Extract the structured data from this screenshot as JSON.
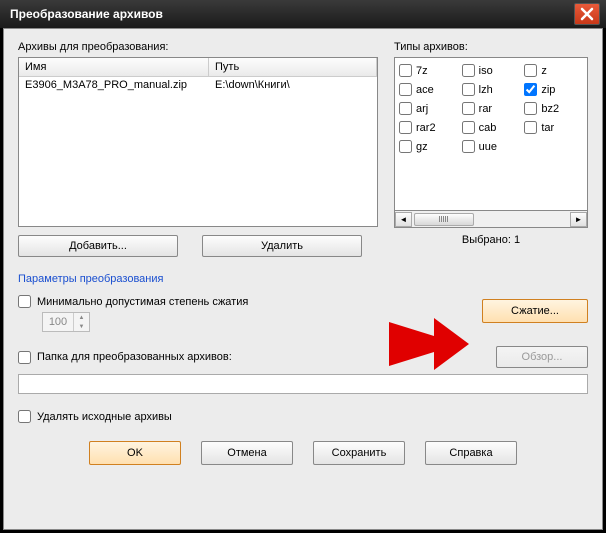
{
  "title": "Преобразование архивов",
  "archives": {
    "label": "Архивы для преобразования:",
    "col_name": "Имя",
    "col_path": "Путь",
    "rows": [
      {
        "name": "E3906_M3A78_PRO_manual.zip",
        "path": "E:\\down\\Книги\\"
      }
    ]
  },
  "types": {
    "label": "Типы архивов:",
    "items": [
      {
        "label": "7z",
        "checked": false
      },
      {
        "label": "iso",
        "checked": false
      },
      {
        "label": "z",
        "checked": false
      },
      {
        "label": "ace",
        "checked": false
      },
      {
        "label": "lzh",
        "checked": false
      },
      {
        "label": "zip",
        "checked": true
      },
      {
        "label": "arj",
        "checked": false
      },
      {
        "label": "rar",
        "checked": false
      },
      {
        "label": "bz2",
        "checked": false
      },
      {
        "label": "rar2",
        "checked": false
      },
      {
        "label": "cab",
        "checked": false
      },
      {
        "label": "tar",
        "checked": false
      },
      {
        "label": "gz",
        "checked": false
      },
      {
        "label": "uue",
        "checked": false
      }
    ],
    "selected_label": "Выбрано: 1"
  },
  "buttons": {
    "add": "Добавить...",
    "remove": "Удалить",
    "compress": "Сжатие...",
    "browse": "Обзор...",
    "ok": "OK",
    "cancel": "Отмена",
    "save": "Сохранить",
    "help": "Справка"
  },
  "params": {
    "title": "Параметры преобразования",
    "min_ratio": "Минимально допустимая степень сжатия",
    "ratio_value": "100",
    "out_folder": "Папка для преобразованных архивов:",
    "out_folder_value": "",
    "delete_src": "Удалять исходные архивы"
  }
}
